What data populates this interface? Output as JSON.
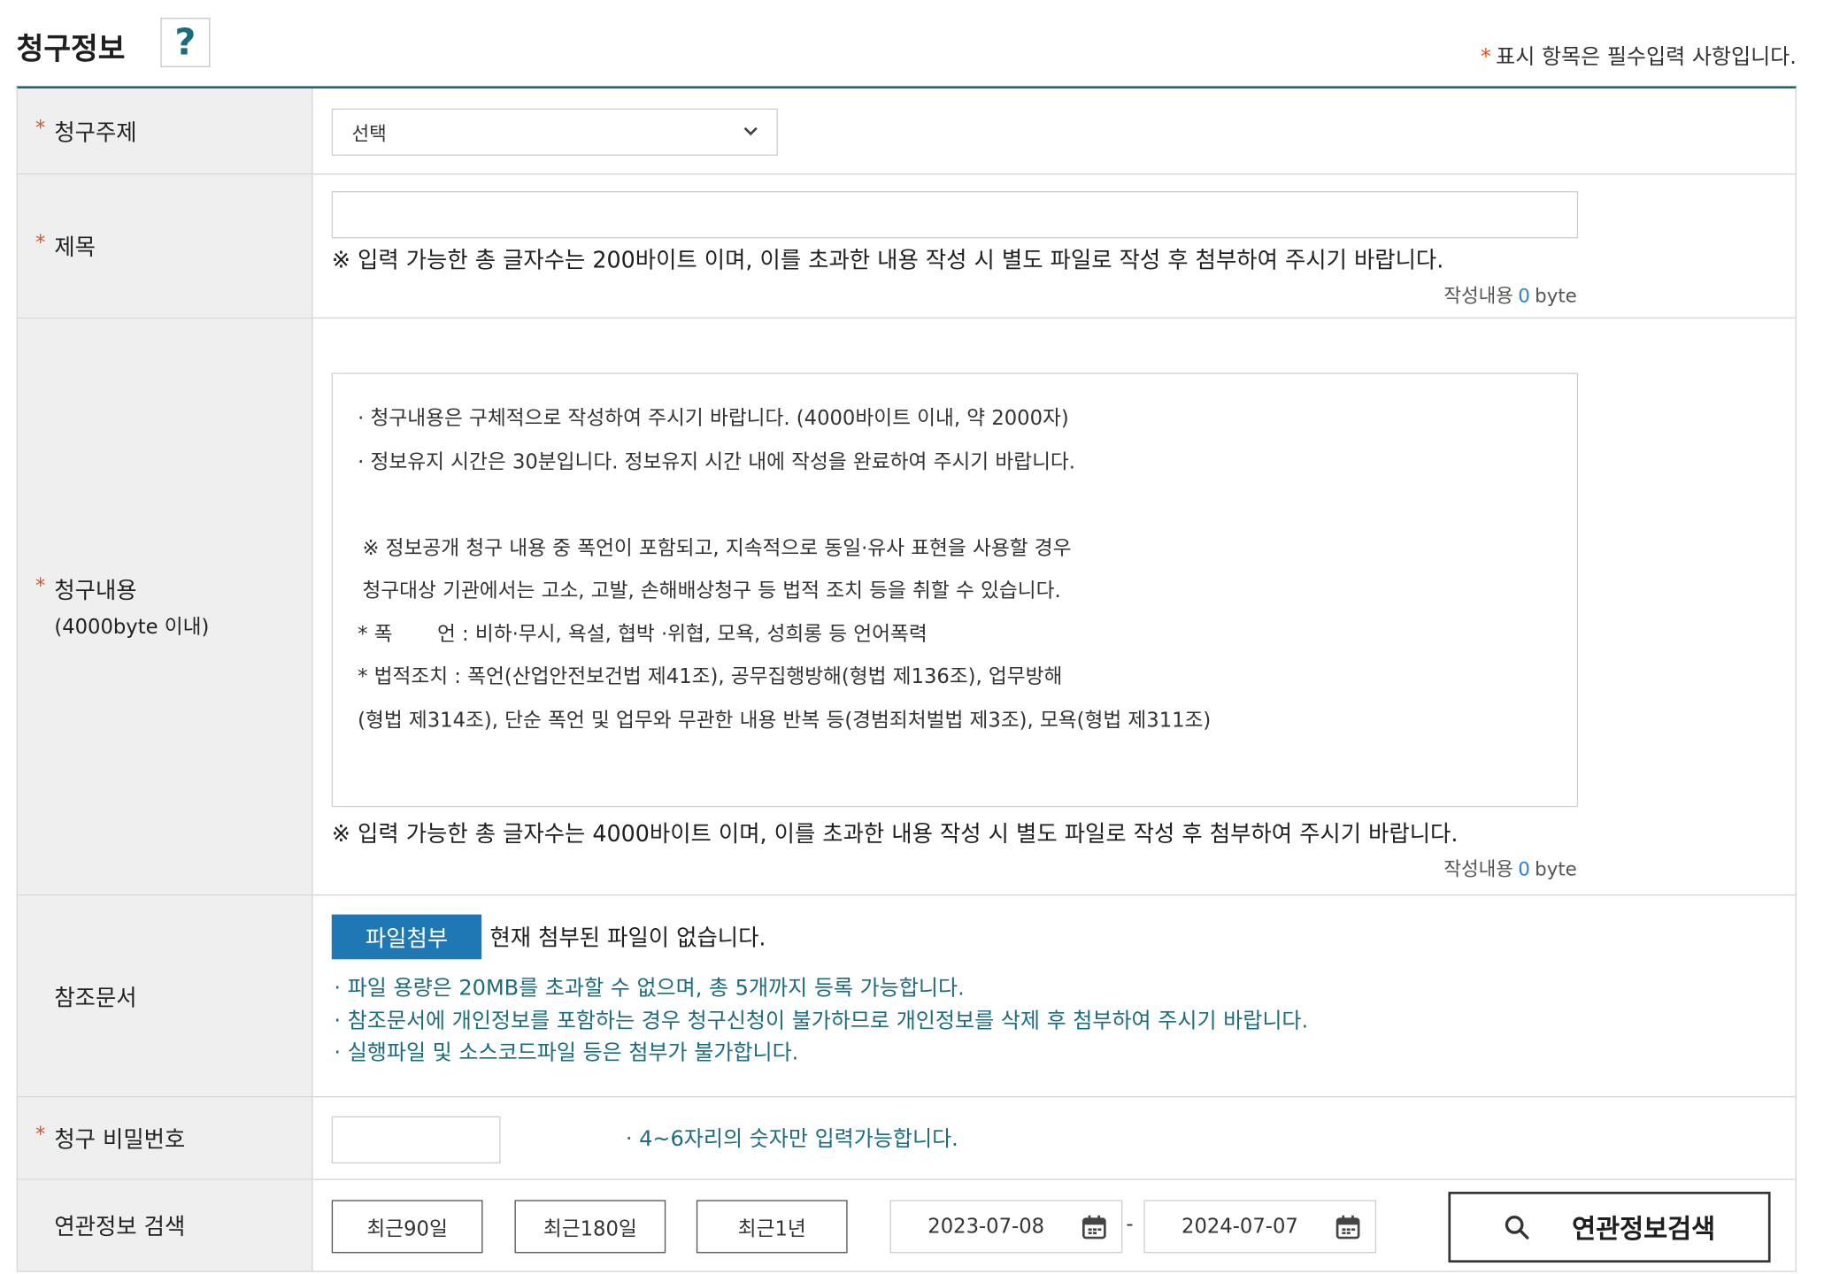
{
  "header": {
    "title": "청구정보",
    "help_label": "?",
    "required_star": "*",
    "required_note": "표시 항목은 필수입력 사항입니다."
  },
  "fields": {
    "subject": {
      "label": "청구주제",
      "select_value": "선택"
    },
    "title": {
      "label": "제목",
      "value": "",
      "note": "※ 입력 가능한 총 글자수는 200바이트 이며, 이를 초과한 내용 작성 시 별도 파일로 작성 후 첨부하여 주시기 바랍니다.",
      "byte_label": "작성내용",
      "byte_count": "0",
      "byte_unit": "byte"
    },
    "content": {
      "label": "청구내용",
      "sublabel": "(4000byte 이내)",
      "placeholder_lines": [
        "· 청구내용은 구체적으로 작성하여 주시기 바랍니다. (4000바이트 이내, 약 2000자)",
        "· 정보유지 시간은 30분입니다. 정보유지 시간 내에 작성을 완료하여 주시기 바랍니다.",
        "※ 정보공개 청구 내용 중 폭언이 포함되고, 지속적으로 동일·유사 표현을 사용할 경우",
        "청구대상 기관에서는 고소, 고발, 손해배상청구 등 법적 조치 등을 취할 수 있습니다.",
        "* 폭       언 : 비하·무시, 욕설, 협박 ·위협, 모욕, 성희롱 등 언어폭력",
        "* 법적조치 : 폭언(산업안전보건법 제41조), 공무집행방해(형법 제136조), 업무방해",
        "(형법 제314조), 단순 폭언 및 업무와 무관한 내용 반복 등(경범죄처벌법 제3조), 모욕(형법 제311조)"
      ],
      "note": "※ 입력 가능한 총 글자수는 4000바이트 이며, 이를 초과한 내용 작성 시 별도 파일로 작성 후 첨부하여 주시기 바랍니다.",
      "byte_label": "작성내용",
      "byte_count": "0",
      "byte_unit": "byte"
    },
    "attachment": {
      "label": "참조문서",
      "button_label": "파일첨부",
      "status": "현재 첨부된 파일이 없습니다.",
      "notes": [
        "· 파일 용량은 20MB를 초과할 수 없으며, 총 5개까지 등록 가능합니다.",
        "· 참조문서에 개인정보를 포함하는 경우 청구신청이 불가하므로 개인정보를 삭제 후 첨부하여 주시기 바랍니다.",
        "· 실행파일 및 소스코드파일 등은 첨부가 불가합니다."
      ]
    },
    "password": {
      "label": "청구 비밀번호",
      "value": "",
      "note": "· 4~6자리의 숫자만 입력가능합니다."
    },
    "related_search": {
      "label": "연관정보 검색",
      "period_buttons": [
        "최근90일",
        "최근180일",
        "최근1년"
      ],
      "date_from": "2023-07-08",
      "date_separator": "-",
      "date_to": "2024-07-07",
      "search_button": "연관정보검색"
    }
  },
  "colors": {
    "accent_teal": "#1d6878",
    "required_star": "#e0541f",
    "file_button": "#1f78b4",
    "info_text": "#1c6c7e",
    "byte_count": "#2a7fd6",
    "label_bg": "#efefef"
  },
  "icons": {
    "help": "question-mark-icon",
    "select": "chevron-down-icon",
    "date": "calendar-icon",
    "search": "search-icon"
  }
}
